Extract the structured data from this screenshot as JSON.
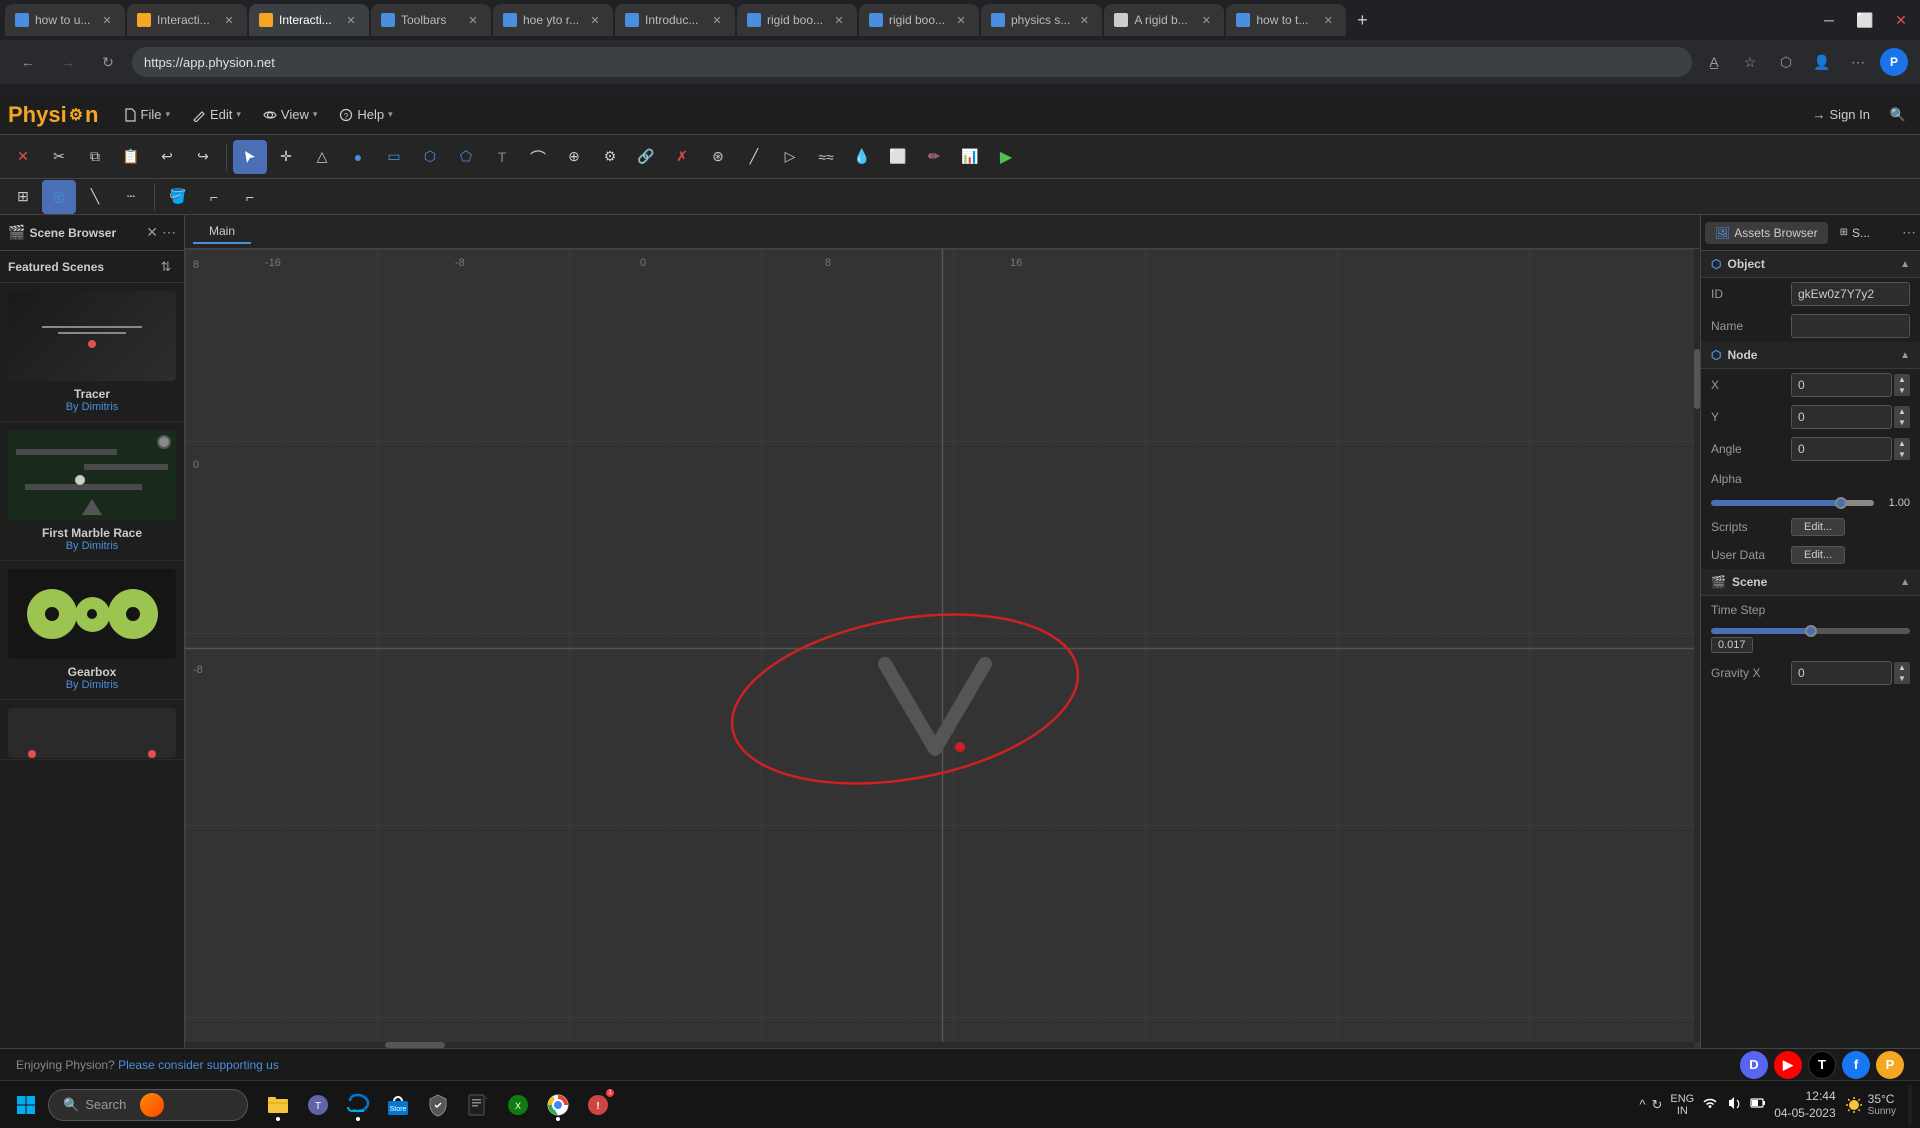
{
  "browser": {
    "tabs": [
      {
        "id": "tab1",
        "title": "how to u...",
        "favicon_color": "#4a8fdd",
        "active": false,
        "url": ""
      },
      {
        "id": "tab2",
        "title": "Interacti...",
        "favicon_color": "#f5a623",
        "active": false,
        "url": ""
      },
      {
        "id": "tab3",
        "title": "Interacti...",
        "favicon_color": "#f5a623",
        "active": true,
        "url": "https://app.physion.net"
      },
      {
        "id": "tab4",
        "title": "Toolbars",
        "favicon_color": "#4a8fdd",
        "active": false,
        "url": ""
      },
      {
        "id": "tab5",
        "title": "hoe yto r...",
        "favicon_color": "#4a8fdd",
        "active": false,
        "url": ""
      },
      {
        "id": "tab6",
        "title": "Introduc...",
        "favicon_color": "#4a8fdd",
        "active": false,
        "url": ""
      },
      {
        "id": "tab7",
        "title": "rigid boo...",
        "favicon_color": "#4a8fdd",
        "active": false,
        "url": ""
      },
      {
        "id": "tab8",
        "title": "rigid boo...",
        "favicon_color": "#4a8fdd",
        "active": false,
        "url": ""
      },
      {
        "id": "tab9",
        "title": "physics s...",
        "favicon_color": "#4a8fdd",
        "active": false,
        "url": ""
      },
      {
        "id": "tab10",
        "title": "A rigid b...",
        "favicon_color": "#ccc",
        "active": false,
        "url": ""
      },
      {
        "id": "tab11",
        "title": "how to t...",
        "favicon_color": "#4a8fdd",
        "active": false,
        "url": ""
      }
    ],
    "address": "https://app.physion.net"
  },
  "app": {
    "name": "Physion",
    "menu": {
      "file": "File",
      "edit": "Edit",
      "view": "View",
      "help": "Help"
    },
    "sign_in": "Sign In"
  },
  "sidebar": {
    "title": "Scene Browser",
    "featured_title": "Featured Scenes",
    "scenes": [
      {
        "name": "Tracer",
        "author": "Dimitris"
      },
      {
        "name": "First Marble Race",
        "author": "Dimitris"
      },
      {
        "name": "Gearbox",
        "author": "Dimitris"
      }
    ]
  },
  "canvas": {
    "tab": "Main",
    "grid": {
      "h_labels": [
        "-16",
        "-8",
        "0",
        "8",
        "16"
      ],
      "v_labels": [
        "8",
        "0",
        "-8"
      ]
    }
  },
  "panels": {
    "assets_browser": "Assets Browser",
    "s_label": "S...",
    "object_section": {
      "title": "Object",
      "id_label": "ID",
      "id_value": "gkEw0z7Y7y2",
      "name_label": "Name",
      "name_value": ""
    },
    "node_section": {
      "title": "Node",
      "x_label": "X",
      "x_value": "0",
      "y_label": "Y",
      "y_value": "0",
      "angle_label": "Angle",
      "angle_value": "0",
      "alpha_label": "Alpha",
      "alpha_value": "1.00",
      "scripts_label": "Scripts",
      "scripts_btn": "Edit...",
      "userdata_label": "User Data",
      "userdata_btn": "Edit..."
    },
    "scene_section": {
      "title": "Scene",
      "timestep_label": "Time Step",
      "timestep_value": "0.017",
      "gravity_x_label": "Gravity X",
      "gravity_x_value": "0"
    }
  },
  "status_bar": {
    "text": "Enjoying Physion?",
    "link_text": "Please consider supporting us"
  },
  "taskbar": {
    "search_placeholder": "Search",
    "time": "12:44",
    "date": "04-05-2023",
    "language": "ENG",
    "region": "IN",
    "weather": "35°C",
    "weather_condition": "Sunny",
    "notification_badge": "1"
  },
  "social": {
    "discord": "D",
    "youtube": "▶",
    "tiktok": "T",
    "facebook": "f",
    "physion": "P"
  }
}
